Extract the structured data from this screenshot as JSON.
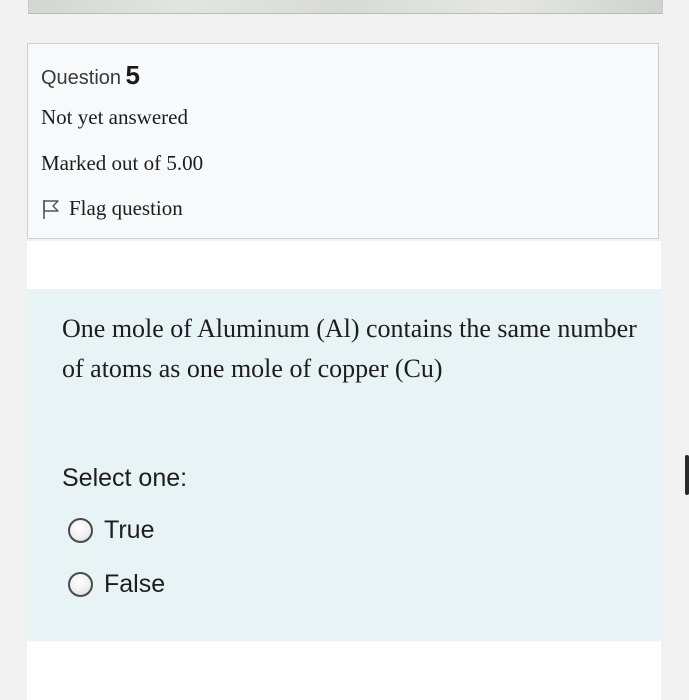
{
  "question": {
    "label": "Question",
    "number": "5",
    "status": "Not yet answered",
    "marks": "Marked out of 5.00",
    "flag_label": "Flag question"
  },
  "content": {
    "text": "One mole of Aluminum (Al) contains the same number of atoms as one mole of copper (Cu)",
    "prompt": "Select one:",
    "options": [
      {
        "label": "True",
        "selected": false
      },
      {
        "label": "False",
        "selected": false
      }
    ]
  },
  "icons": {
    "flag": "flag-outline-icon",
    "radio": "radio-unchecked-icon"
  },
  "colors": {
    "background": "#f2f2f2",
    "info_box": "#f8f9fa",
    "content_box": "#e7f3f5",
    "text": "#1d1d1d"
  }
}
